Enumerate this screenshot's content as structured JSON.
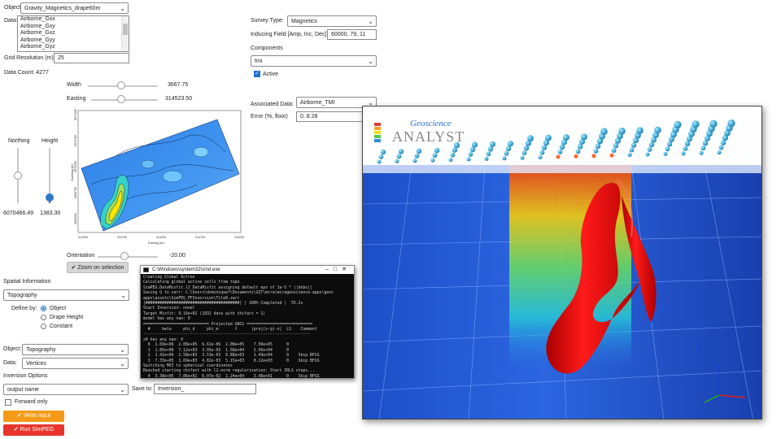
{
  "left": {
    "object_label": "Object:",
    "object_value": "Gravity_Magnetics_drape60m",
    "data_label": "Data:",
    "data_items": [
      "Airborne_Gxx",
      "Airborne_Gxy",
      "Airborne_Gxz",
      "Airborne_Gyy",
      "Airborne_Gyz"
    ],
    "grid_label": "Grid Resolution (m)",
    "grid_value": "25",
    "data_count": "Data Count: 4277",
    "width_label": "Width",
    "width_value": "3667.75",
    "width_fraction": 0.48,
    "easting_label": "Easting",
    "easting_value": "314523.50",
    "easting_fraction": 0.45,
    "northing_label": "Northing",
    "northing_value": "6070466.49",
    "northing_fraction": 0.5,
    "height_label": "Height",
    "height_value": "1383.30",
    "height_fraction": 0.1,
    "orientation_label": "Orientation",
    "orientation_value": "-20.00",
    "orientation_fraction": 0.45,
    "zoom_button": "Zoom on selection",
    "spatial_title": "Spatial Information",
    "topography_value": "Topography",
    "define_by_label": "Define by:",
    "define_options": [
      "Object",
      "Drape Height",
      "Constant"
    ],
    "define_selected": 0,
    "object2_label": "Object:",
    "object2_value": "Topography",
    "data2_label": "Data:",
    "data2_value": "Vertices",
    "inversion_title": "Inversion Options",
    "output_value": "output name",
    "save_to_label": "Save to:",
    "save_to_value": "Inversion_",
    "forward_only_label": "Forward only",
    "forward_only_checked": false,
    "write_button": "Write input",
    "run_button": "Run SimPEG"
  },
  "right": {
    "survey_type_label": "Survey Type:",
    "survey_type_value": "Magnetics",
    "inducing_label": "Inducing Field [Amp, Inc, Dec]",
    "inducing_value": "60000, 79, 11",
    "components_label": "Components",
    "components_value": "tmi",
    "active_label": "Active",
    "active_checked": true,
    "assoc_label": "Associated Data:",
    "assoc_value": "Airborne_TMI",
    "error_label": "Error (%, floor)",
    "error_value": "0, 8.28"
  },
  "console": {
    "title": "C:\\Windows\\system32\\cmd.exe",
    "lines": [
      "Creating Global Octree",
      "Calculating global active cells from topo",
      "SimPEG.DataMisfit.l2_DataMisfit assigning default eps of 1e-5 * ||dobs||",
      "Saving G to zarr: C:\\Users\\dominiquef\\Documents\\GIT\\mira\\mirageoscience-apps\\geos",
      "apps\\assets\\SimPEG_PFInversion\\Tile0.zarr",
      "[########################################] | 100% Completed |  55.2s",
      "Start Inversion: nonel",
      "Target Misfit: 9.16e+02 (1832 data with chifact = 1)",
      "model has any nan: 0",
      "============================ Projected GNCG ============================",
      "  #     beta     phi_d     phi_m       f      |proj(x-g)-x|  LS    Comment",
      "-----------------------------------------------------------------------",
      "x0 has any nan: 0",
      "  0  1.69e+06  2.08e+05  6.61e-06  2.08e+05    7.99e+05      0",
      "  1  1.85e+06  7.12e+03  3.05e-03  1.58e+04    2.56e+04      0",
      "  2  1.42e+06  2.58e+03  3.53e-03  8.88e+03    1.43e+04      0    Skip BFGS",
      "  3  7.33e+05  1.69e+03  4.82e-03  5.15e+03    8.12e+03      0    Skip BFGS",
      "Switching MVI to spherical coordinates",
      "Reached starting chifact with l2-norm regularization: Start IRLS steps...",
      "  4  3.38e+05  7.86e+02  6.07e-02  2.24e+04    3.48e+01      0    Skip BFGS"
    ]
  },
  "plot": {
    "y_ticks": [
      "6071250",
      "6070750",
      "6070250",
      "6069750",
      "6069250"
    ],
    "x_ticks": [
      "313250",
      "313750",
      "314250",
      "314750",
      "315250"
    ],
    "x_label": "Easting (m)",
    "y_label": "Northing (m)"
  },
  "viewer": {
    "logo_top": "Geoscience",
    "logo_bottom": "ANALYST",
    "axis_label": "Z"
  },
  "colors": {
    "write_button": "#f59a16",
    "run_button": "#e8362b",
    "accent": "#1f6fd1"
  }
}
